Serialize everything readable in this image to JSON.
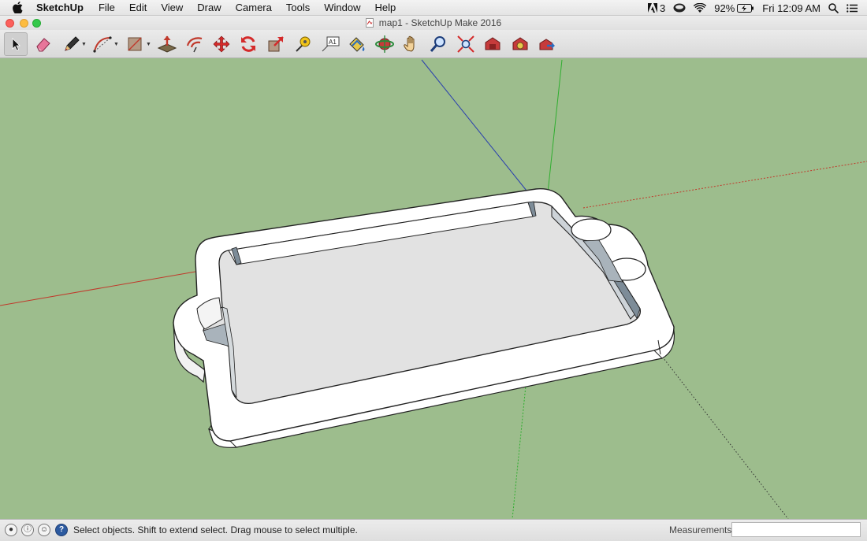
{
  "menubar": {
    "app_name": "SketchUp",
    "menus": [
      "File",
      "Edit",
      "View",
      "Draw",
      "Camera",
      "Tools",
      "Window",
      "Help"
    ],
    "status": {
      "adobe_count": "3",
      "battery": "92%",
      "clock": "Fri 12:09 AM"
    }
  },
  "window": {
    "title": "map1 - SketchUp Make 2016"
  },
  "toolbar": {
    "tools": [
      {
        "name": "select-tool",
        "icon": "arrow-cursor-icon",
        "active": true
      },
      {
        "name": "eraser-tool",
        "icon": "eraser-icon"
      },
      {
        "name": "pencil-line-tool",
        "icon": "pencil-icon"
      },
      {
        "name": "arc-tool",
        "icon": "arc-icon"
      },
      {
        "name": "rectangle-tool",
        "icon": "rectangle-icon"
      },
      {
        "name": "push-pull-tool",
        "icon": "push-pull-icon"
      },
      {
        "name": "offset-tool",
        "icon": "offset-icon"
      },
      {
        "name": "move-tool",
        "icon": "move-arrows-icon"
      },
      {
        "name": "rotate-tool",
        "icon": "rotate-icon"
      },
      {
        "name": "scale-tool",
        "icon": "scale-icon"
      },
      {
        "name": "tape-measure-tool",
        "icon": "tape-measure-icon"
      },
      {
        "name": "text-tool",
        "icon": "text-label-icon"
      },
      {
        "name": "paint-bucket-tool",
        "icon": "paint-bucket-icon"
      },
      {
        "name": "orbit-tool",
        "icon": "orbit-icon"
      },
      {
        "name": "pan-tool",
        "icon": "hand-icon"
      },
      {
        "name": "zoom-tool",
        "icon": "magnifier-icon"
      },
      {
        "name": "zoom-extents-tool",
        "icon": "zoom-extents-icon"
      },
      {
        "name": "warehouse-tool",
        "icon": "warehouse-icon"
      },
      {
        "name": "extension-warehouse-tool",
        "icon": "extension-warehouse-icon"
      },
      {
        "name": "share-model-tool",
        "icon": "share-model-icon"
      }
    ],
    "text_tool_glyph": "A1"
  },
  "statusbar": {
    "message": "Select objects. Shift to extend select. Drag mouse to select multiple.",
    "measurements_label": "Measurements",
    "measurements_value": ""
  },
  "colors": {
    "ground": "#9dbd8d",
    "model_face": "#ffffff",
    "model_inner": "#e2e2e2",
    "model_shadow": "#7d8c98",
    "axis_red": "#c0392b",
    "axis_green": "#2fae2f",
    "axis_blue": "#2a3fae"
  }
}
